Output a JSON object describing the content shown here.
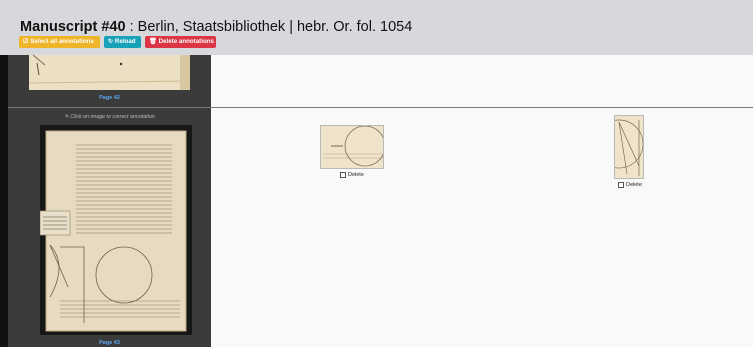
{
  "header": {
    "title_bold": "Manuscript #40",
    "title_rest": " : Berlin, Staatsbibliothek | hebr. Or. fol. 1054"
  },
  "toolbar": {
    "select_all_label": "Select all annotations",
    "reload_label": "Reload",
    "delete_label": "Delete annotations"
  },
  "sidebar": {
    "page_prev_label": "Page 42",
    "click_hint": "Click on image to correct annotation",
    "page_current_label": "Page 43"
  },
  "annotations": [
    {
      "delete_label": "Delete"
    },
    {
      "delete_label": "Delete"
    }
  ],
  "colors": {
    "select_all": "#f0b428",
    "reload": "#17a2b8",
    "delete": "#dc3545",
    "page_label": "#5aa9f2"
  }
}
